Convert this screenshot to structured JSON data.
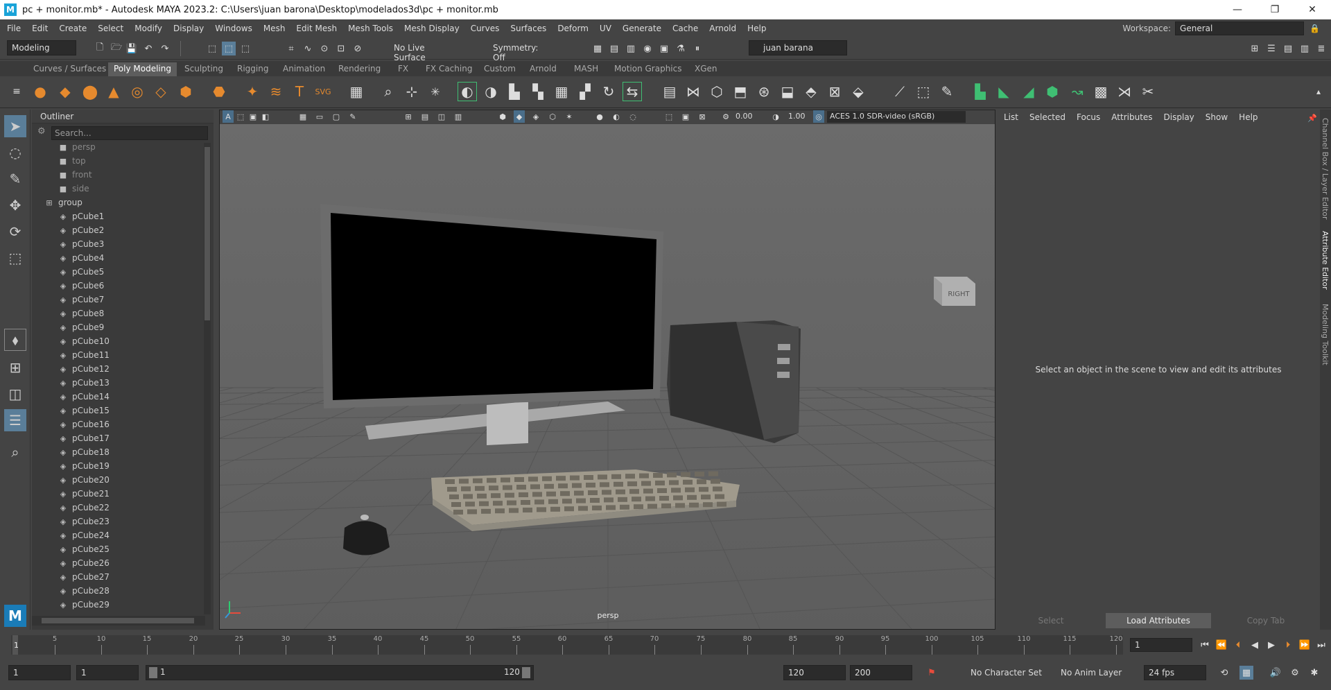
{
  "window": {
    "title": "pc + monitor.mb* - Autodesk MAYA 2023.2: C:\\Users\\juan barona\\Desktop\\modelados3d\\pc + monitor.mb",
    "minimize": "—",
    "maximize": "❐",
    "close": "✕",
    "logo": "M"
  },
  "menu": [
    "File",
    "Edit",
    "Create",
    "Select",
    "Modify",
    "Display",
    "Windows",
    "Mesh",
    "Edit Mesh",
    "Mesh Tools",
    "Mesh Display",
    "Curves",
    "Surfaces",
    "Deform",
    "UV",
    "Generate",
    "Cache",
    "Arnold",
    "Help"
  ],
  "workspace": {
    "label": "Workspace:",
    "value": "General"
  },
  "status": {
    "mode": "Modeling",
    "live_surface": "No Live Surface",
    "symmetry": "Symmetry: Off",
    "user": "juan barana"
  },
  "shelf_tabs": [
    "Curves / Surfaces",
    "Poly Modeling",
    "Sculpting",
    "Rigging",
    "Animation",
    "Rendering",
    "FX",
    "FX Caching",
    "Custom",
    "Arnold",
    "MASH",
    "Motion Graphics",
    "XGen"
  ],
  "active_shelf": "Poly Modeling",
  "outliner": {
    "title": "Outliner",
    "search_placeholder": "Search...",
    "cameras": [
      "persp",
      "top",
      "front",
      "side"
    ],
    "group": "group",
    "meshes": [
      "pCube1",
      "pCube2",
      "pCube3",
      "pCube4",
      "pCube5",
      "pCube6",
      "pCube7",
      "pCube8",
      "pCube9",
      "pCube10",
      "pCube11",
      "pCube12",
      "pCube13",
      "pCube14",
      "pCube15",
      "pCube16",
      "pCube17",
      "pCube18",
      "pCube19",
      "pCube20",
      "pCube21",
      "pCube22",
      "pCube23",
      "pCube24",
      "pCube25",
      "pCube26",
      "pCube27",
      "pCube28",
      "pCube29"
    ]
  },
  "viewport": {
    "near": "0.00",
    "far": "1.00",
    "color_space": "ACES 1.0 SDR-video (sRGB)",
    "camera_label": "persp",
    "view_cube": "RIGHT"
  },
  "attribute_editor": {
    "menus": [
      "List",
      "Selected",
      "Focus",
      "Attributes",
      "Display",
      "Show",
      "Help"
    ],
    "message": "Select an object in the scene to view and edit its attributes",
    "buttons": [
      "Select",
      "Load Attributes",
      "Copy Tab"
    ]
  },
  "side_tabs": [
    "Channel Box / Layer Editor",
    "Attribute Editor",
    "Modeling Toolkit"
  ],
  "timeline": {
    "ticks": [
      "5",
      "10",
      "15",
      "20",
      "25",
      "30",
      "35",
      "40",
      "45",
      "50",
      "55",
      "60",
      "65",
      "70",
      "75",
      "80",
      "85",
      "90",
      "95",
      "100",
      "105",
      "110",
      "115",
      "120"
    ],
    "start_marker": "1",
    "current_frame": "1"
  },
  "range": {
    "start": "1",
    "start2": "1",
    "slider_start": "1",
    "slider_end": "120",
    "end": "120",
    "end2": "200",
    "char_set": "No Character Set",
    "anim_layer": "No Anim Layer",
    "fps": "24 fps"
  }
}
